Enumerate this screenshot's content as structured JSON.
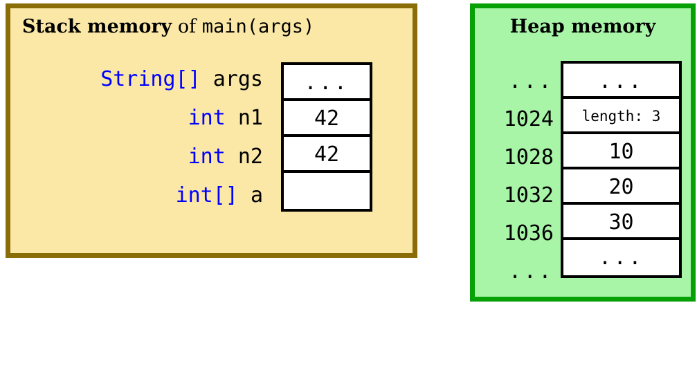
{
  "diagram": {
    "colors": {
      "stack_fill": "#fbe8a6",
      "stack_border": "#8a6d07",
      "heap_fill": "#a8f5a8",
      "heap_border": "#07a007",
      "type_keyword": "#0000ff",
      "identifier": "#000000",
      "cell_fill": "#ffffff",
      "cell_border": "#000000"
    }
  },
  "stack": {
    "title": {
      "bold_part": "Stack memory",
      "connector": " of ",
      "mono_part": "main(args)"
    },
    "rows": [
      {
        "type": "String[]",
        "name": "args",
        "value": "..."
      },
      {
        "type": "int",
        "name": "n1",
        "value": "42"
      },
      {
        "type": "int",
        "name": "n2",
        "value": "42"
      },
      {
        "type": "int[]",
        "name": "a",
        "value": ""
      }
    ]
  },
  "heap": {
    "title": "Heap memory",
    "rows": [
      {
        "address": "...",
        "value": "...",
        "small": false
      },
      {
        "address": "1024",
        "value": "length: 3",
        "small": true
      },
      {
        "address": "1028",
        "value": "10",
        "small": false
      },
      {
        "address": "1032",
        "value": "20",
        "small": false
      },
      {
        "address": "1036",
        "value": "30",
        "small": false
      },
      {
        "address": "...",
        "value": "...",
        "small": false
      }
    ]
  }
}
